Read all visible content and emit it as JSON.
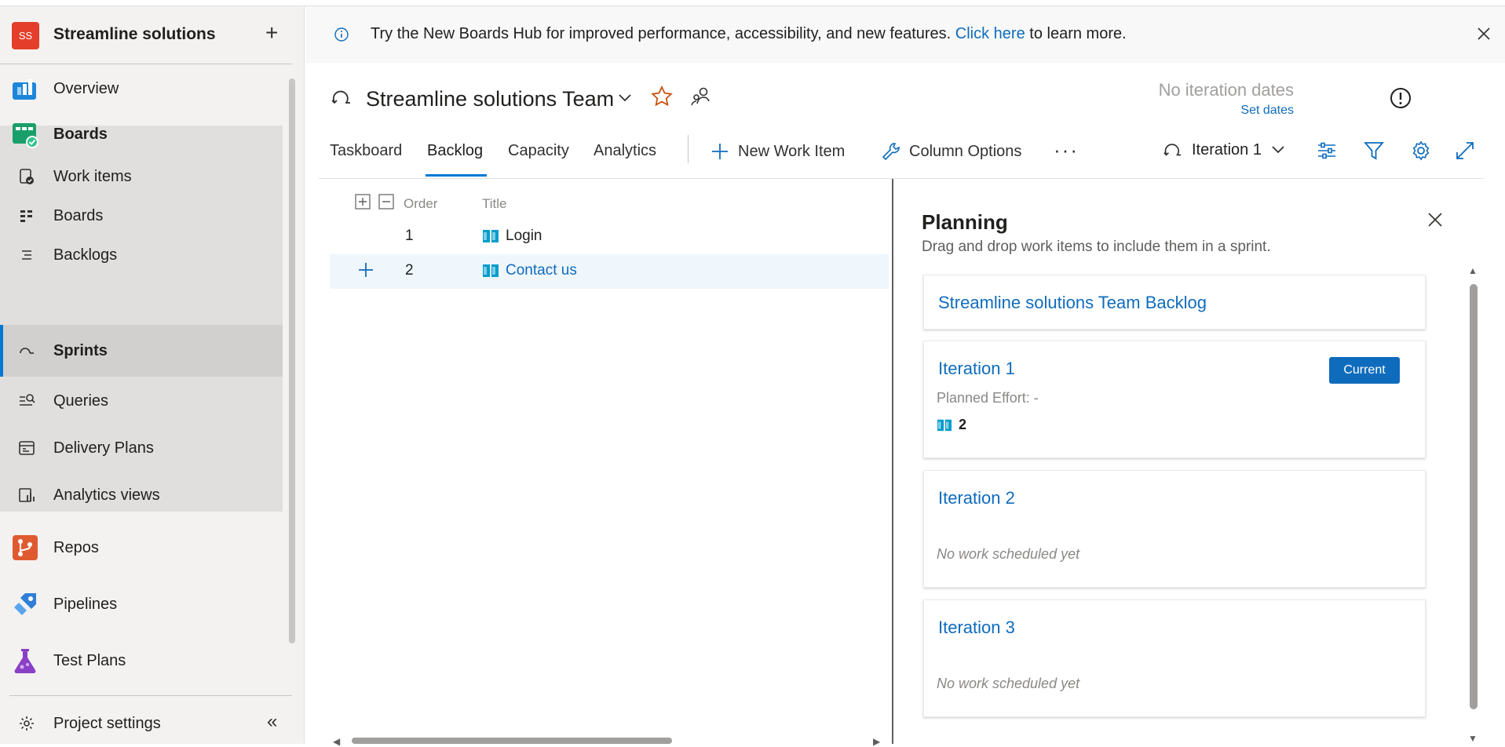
{
  "org": {
    "initials": "SS",
    "name": "Streamline solutions"
  },
  "sidebar": {
    "overview": "Overview",
    "boards": "Boards",
    "sub_items": [
      "Work items",
      "Boards",
      "Backlogs",
      "Sprints",
      "Queries",
      "Delivery Plans",
      "Analytics views"
    ],
    "repos": "Repos",
    "pipelines": "Pipelines",
    "test_plans": "Test Plans",
    "project_settings": "Project settings"
  },
  "banner": {
    "message": "Try the New Boards Hub for improved performance, accessibility, and new features.",
    "link": "Click here",
    "suffix": "to learn more."
  },
  "header": {
    "team": "Streamline solutions Team",
    "no_dates": "No iteration dates",
    "set_dates": "Set dates"
  },
  "tabs": [
    "Taskboard",
    "Backlog",
    "Capacity",
    "Analytics"
  ],
  "toolbar": {
    "new_work_item": "New Work Item",
    "column_options": "Column Options",
    "more": "···",
    "iteration": "Iteration 1"
  },
  "grid": {
    "columns": {
      "order": "Order",
      "title": "Title"
    },
    "rows": [
      {
        "order": "1",
        "title": "Login"
      },
      {
        "order": "2",
        "title": "Contact us"
      }
    ]
  },
  "planning": {
    "title": "Planning",
    "subtitle": "Drag and drop work items to include them in a sprint.",
    "backlog": "Streamline solutions Team Backlog",
    "iterations": [
      {
        "name": "Iteration 1",
        "badge": "Current",
        "effort": "Planned Effort: -",
        "count": "2"
      },
      {
        "name": "Iteration 2",
        "empty": "No work scheduled yet"
      },
      {
        "name": "Iteration 3",
        "empty": "No work scheduled yet"
      }
    ]
  },
  "colors": {
    "accent": "#0078d4",
    "link": "#0f6cbd",
    "org_avatar": "#e43e2b",
    "star": "#ca5010"
  }
}
